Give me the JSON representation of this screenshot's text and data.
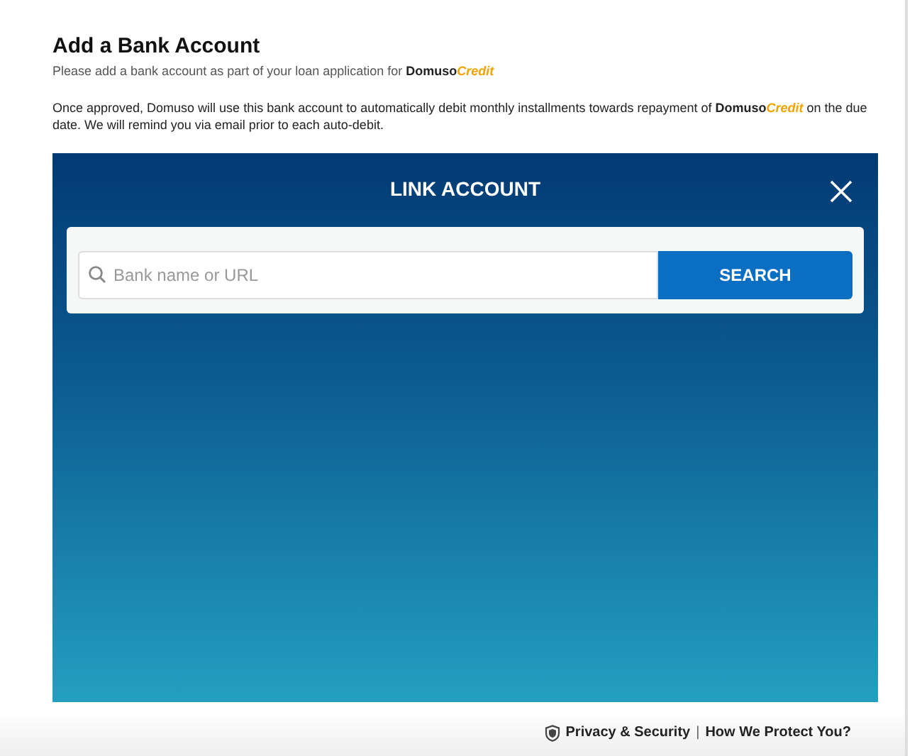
{
  "page": {
    "title": "Add a Bank Account",
    "subtitle": [
      {
        "kind": "plain",
        "text": "Please add a bank account as part of your loan application for "
      },
      {
        "kind": "brand",
        "text": "Domuso"
      },
      {
        "kind": "accent",
        "text": "Credit"
      }
    ],
    "description": [
      {
        "kind": "plain",
        "text": "Once approved, Domuso will use this bank account to automatically debit monthly installments towards repayment of "
      },
      {
        "kind": "brand",
        "text": "Domuso"
      },
      {
        "kind": "accent",
        "text": "Credit"
      },
      {
        "kind": "plain",
        "text": " on the due date. We will remind you via email prior to each auto-debit."
      }
    ]
  },
  "modal": {
    "title": "LINK ACCOUNT",
    "search": {
      "placeholder": "Bank name or URL",
      "button": "SEARCH"
    }
  },
  "footer": {
    "links": [
      "Privacy & Security",
      "How We Protect You?"
    ],
    "separator": "|"
  }
}
